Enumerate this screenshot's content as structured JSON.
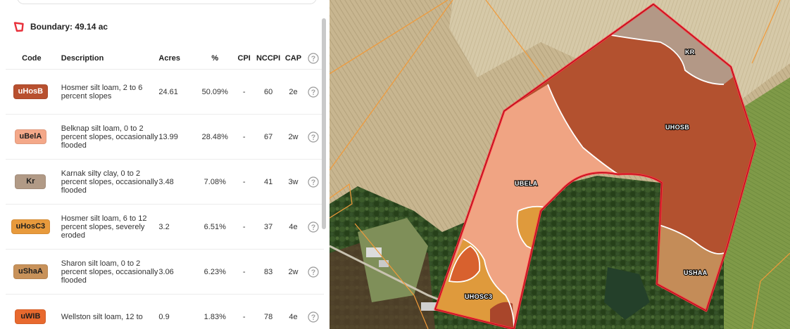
{
  "boundary": {
    "label": "Boundary: 49.14 ac",
    "color": "#e8313b"
  },
  "table": {
    "headers": {
      "code": "Code",
      "description": "Description",
      "acres": "Acres",
      "pct": "%",
      "cpi": "CPI",
      "nccpi": "NCCPI",
      "cap": "CAP"
    },
    "rows": [
      {
        "code": "uHosB",
        "color": "#b8502f",
        "text_color": "#ffffff",
        "description": "Hosmer silt loam, 2 to 6 percent slopes",
        "acres": "24.61",
        "pct": "50.09%",
        "cpi": "-",
        "nccpi": "60",
        "cap": "2e"
      },
      {
        "code": "uBelA",
        "color": "#f4a889",
        "text_color": "#1d1d1d",
        "description": "Belknap silt loam, 0 to 2 percent slopes, occasionally flooded",
        "acres": "13.99",
        "pct": "28.48%",
        "cpi": "-",
        "nccpi": "67",
        "cap": "2w"
      },
      {
        "code": "Kr",
        "color": "#b19a86",
        "text_color": "#1d1d1d",
        "description": "Karnak silty clay, 0 to 2 percent slopes, occasionally flooded",
        "acres": "3.48",
        "pct": "7.08%",
        "cpi": "-",
        "nccpi": "41",
        "cap": "3w"
      },
      {
        "code": "uHosC3",
        "color": "#e89a3c",
        "text_color": "#1d1d1d",
        "description": "Hosmer silt loam, 6 to 12 percent slopes, severely eroded",
        "acres": "3.2",
        "pct": "6.51%",
        "cpi": "-",
        "nccpi": "37",
        "cap": "4e"
      },
      {
        "code": "uShaA",
        "color": "#c8925a",
        "text_color": "#1d1d1d",
        "description": "Sharon silt loam, 0 to 2 percent slopes, occasionally flooded",
        "acres": "3.06",
        "pct": "6.23%",
        "cpi": "-",
        "nccpi": "83",
        "cap": "2w"
      },
      {
        "code": "uWIB",
        "color": "#e8692e",
        "text_color": "#1d1d1d",
        "description": "Wellston silt loam, 12 to",
        "acres": "0.9",
        "pct": "1.83%",
        "cpi": "-",
        "nccpi": "78",
        "cap": "4e"
      }
    ],
    "help_icon": "question-circle-icon"
  },
  "map": {
    "labels": {
      "uhosb": "UHOSB",
      "ubela": "UBELA",
      "kr": "KR",
      "ushaa": "USHAA",
      "uhosc3": "UHOSC3"
    },
    "colors": {
      "boundary": "#ff2d3a",
      "uhosb": "#b3512f",
      "ubela": "#f0a483",
      "kr": "#b39886",
      "ushaa": "#c48c58",
      "uhosc3": "#df9a3c",
      "uwib": "#d8612e"
    }
  }
}
